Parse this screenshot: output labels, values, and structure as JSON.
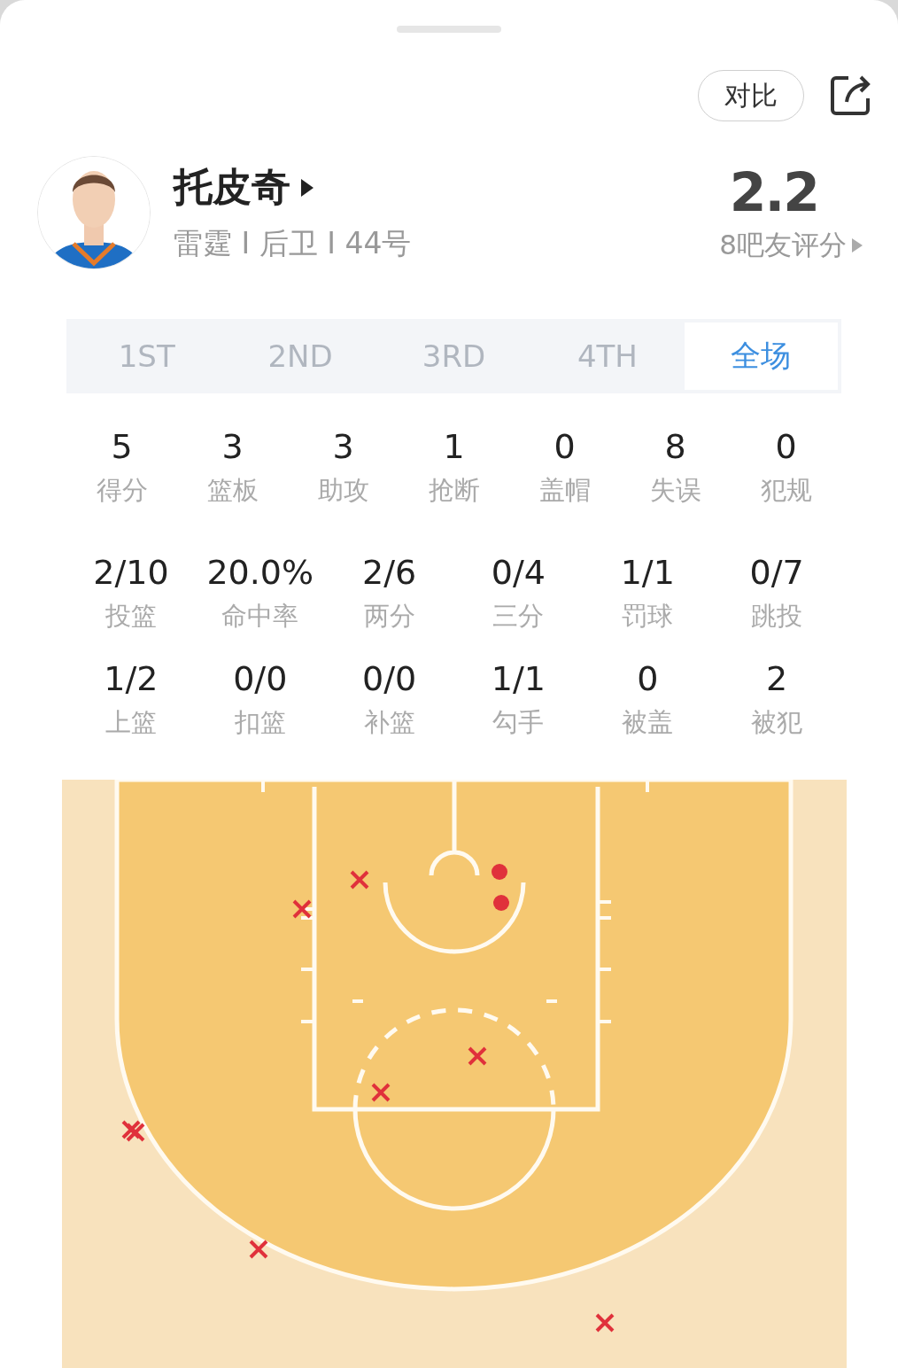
{
  "header": {
    "compare_button": "对比"
  },
  "player": {
    "name": "托皮奇",
    "info": "雷霆 I 后卫 I 44号",
    "rating": "2.2",
    "rating_count": "8吧友评分"
  },
  "tabs": [
    {
      "label": "1ST",
      "selected": false
    },
    {
      "label": "2ND",
      "selected": false
    },
    {
      "label": "3RD",
      "selected": false
    },
    {
      "label": "4TH",
      "selected": false
    },
    {
      "label": "全场",
      "selected": true
    }
  ],
  "stat_rows": [
    {
      "items": [
        {
          "value": "5",
          "label": "得分"
        },
        {
          "value": "3",
          "label": "篮板"
        },
        {
          "value": "3",
          "label": "助攻"
        },
        {
          "value": "1",
          "label": "抢断"
        },
        {
          "value": "0",
          "label": "盖帽"
        },
        {
          "value": "8",
          "label": "失误"
        },
        {
          "value": "0",
          "label": "犯规"
        }
      ]
    },
    {
      "items": [
        {
          "value": "2/10",
          "label": "投篮"
        },
        {
          "value": "20.0%",
          "label": "命中率"
        },
        {
          "value": "2/6",
          "label": "两分"
        },
        {
          "value": "0/4",
          "label": "三分"
        },
        {
          "value": "1/1",
          "label": "罚球"
        },
        {
          "value": "0/7",
          "label": "跳投"
        }
      ]
    },
    {
      "items": [
        {
          "value": "1/2",
          "label": "上篮"
        },
        {
          "value": "0/0",
          "label": "扣篮"
        },
        {
          "value": "0/0",
          "label": "补篮"
        },
        {
          "value": "1/1",
          "label": "勾手"
        },
        {
          "value": "0",
          "label": "被盖"
        },
        {
          "value": "2",
          "label": "被犯"
        }
      ]
    }
  ],
  "shots": [
    {
      "made": false
    },
    {
      "made": false
    },
    {
      "made": false
    },
    {
      "made": false
    },
    {
      "made": false
    },
    {
      "made": false
    },
    {
      "made": false
    },
    {
      "made": false
    },
    {
      "made": true
    },
    {
      "made": true
    }
  ]
}
